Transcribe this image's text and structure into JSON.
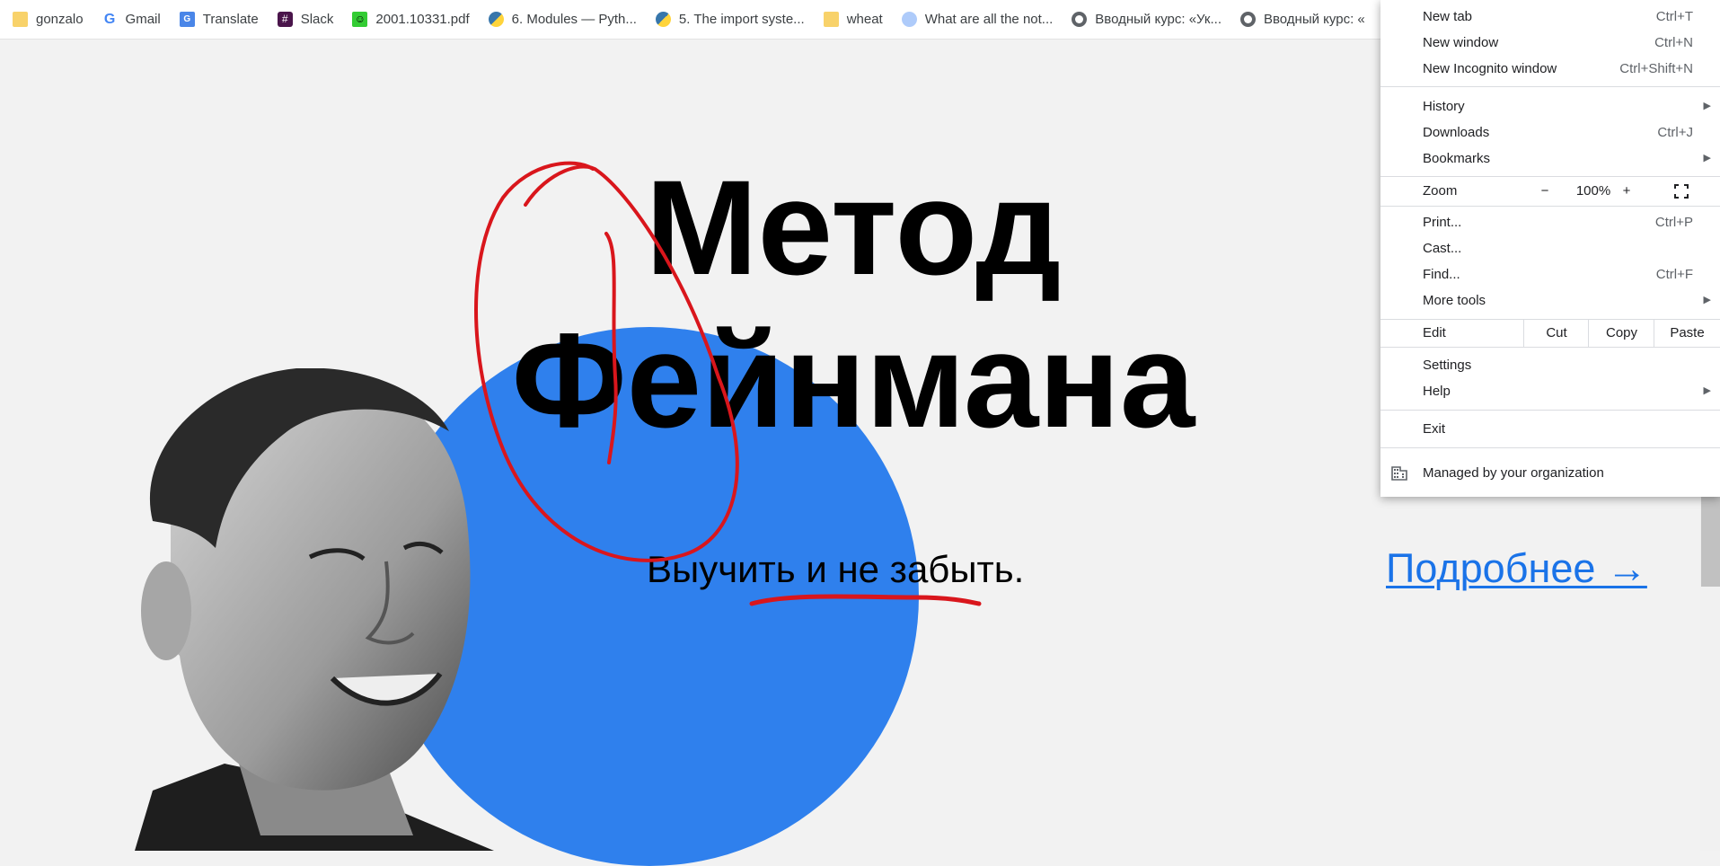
{
  "bookmarks": [
    {
      "label": "gonzalo",
      "icon": "folder-icon"
    },
    {
      "label": "Gmail",
      "icon": "google-icon"
    },
    {
      "label": "Translate",
      "icon": "translate-icon"
    },
    {
      "label": "Slack",
      "icon": "slack-icon"
    },
    {
      "label": "2001.10331.pdf",
      "icon": "smiley-icon"
    },
    {
      "label": "6. Modules — Pyth...",
      "icon": "python-icon"
    },
    {
      "label": "5. The import syste...",
      "icon": "python-icon"
    },
    {
      "label": "wheat",
      "icon": "folder-icon"
    },
    {
      "label": "What are all the not...",
      "icon": "wolfram-icon"
    },
    {
      "label": "Вводный курс: «Ук...",
      "icon": "globe-icon"
    },
    {
      "label": "Вводный курс: «",
      "icon": "globe-icon"
    }
  ],
  "page": {
    "title_line1": "Метод",
    "title_line2": "Фейнмана",
    "subtitle": "Выучить и не забыть.",
    "more_link": "Подробнее →",
    "accent_color": "#2f80ed",
    "link_color": "#1a73e8"
  },
  "menu": {
    "new_tab": "New tab",
    "new_tab_sc": "Ctrl+T",
    "new_window": "New window",
    "new_window_sc": "Ctrl+N",
    "new_incognito": "New Incognito window",
    "new_incognito_sc": "Ctrl+Shift+N",
    "history": "History",
    "downloads": "Downloads",
    "downloads_sc": "Ctrl+J",
    "bookmarks": "Bookmarks",
    "zoom": "Zoom",
    "zoom_minus": "−",
    "zoom_value": "100%",
    "zoom_plus": "+",
    "print": "Print...",
    "print_sc": "Ctrl+P",
    "cast": "Cast...",
    "find": "Find...",
    "find_sc": "Ctrl+F",
    "more_tools": "More tools",
    "edit": "Edit",
    "cut": "Cut",
    "copy": "Copy",
    "paste": "Paste",
    "settings": "Settings",
    "help": "Help",
    "exit": "Exit",
    "managed": "Managed by your organization"
  },
  "annotation_color": "#d9161c"
}
